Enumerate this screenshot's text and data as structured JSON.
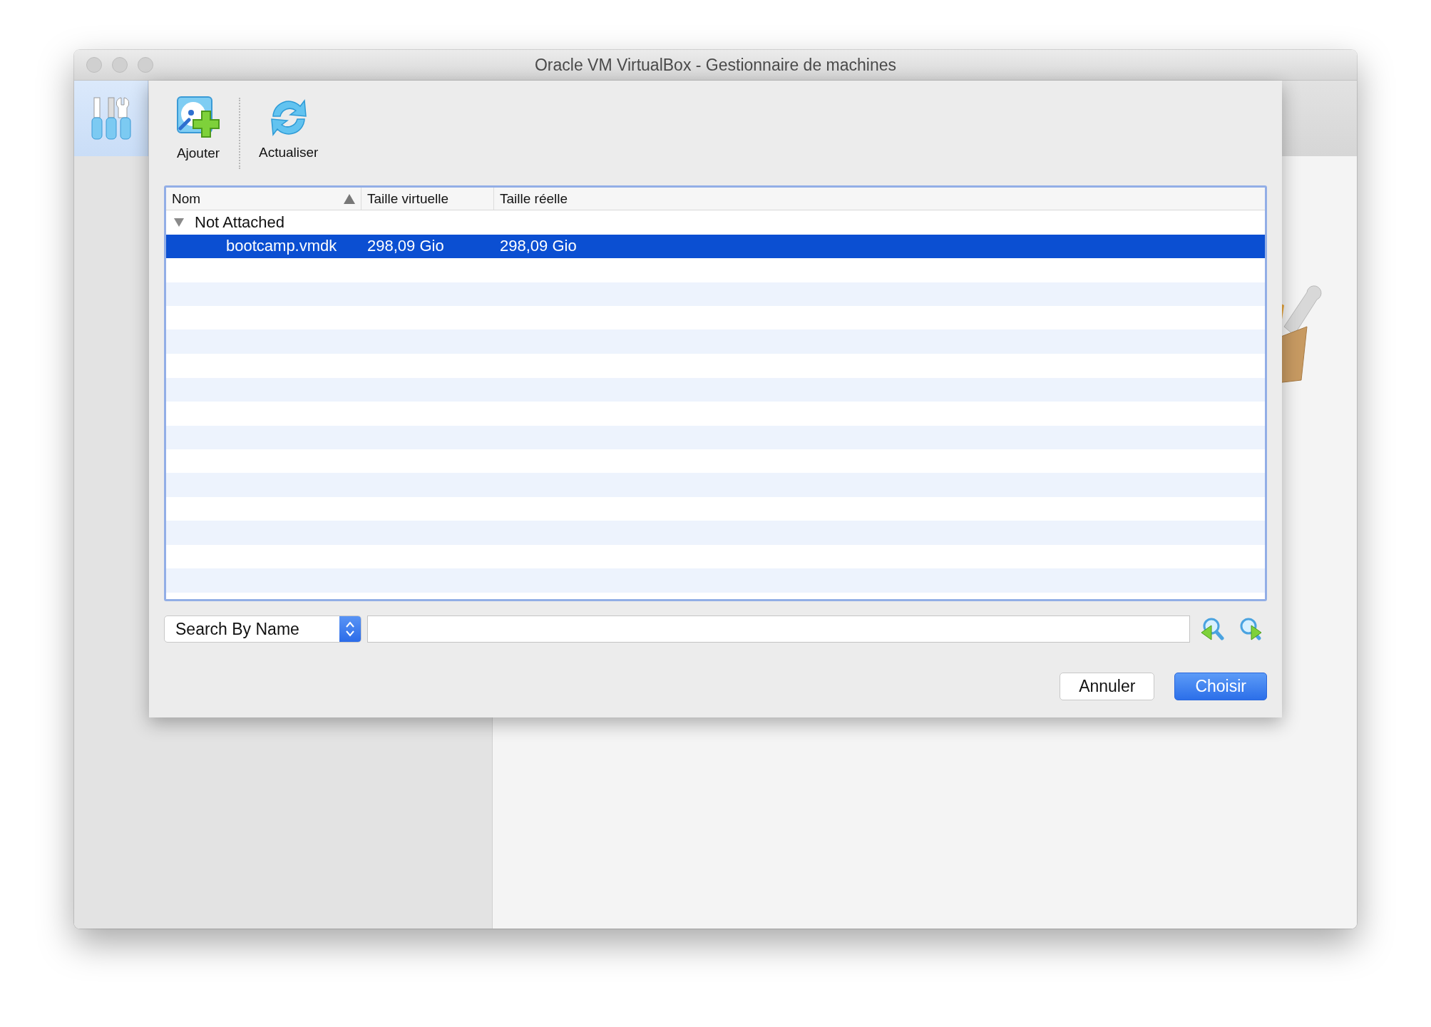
{
  "window": {
    "title": "Oracle VM VirtualBox - Gestionnaire de machines"
  },
  "sidebar": {
    "tools_button": {
      "selected": true
    }
  },
  "toolbar": [
    {
      "label": "Ajouter",
      "kind": "add"
    },
    {
      "label": "Actualiser",
      "kind": "refresh"
    }
  ],
  "table": {
    "columns": [
      {
        "label": "Nom",
        "sorted": true
      },
      {
        "label": "Taille virtuelle",
        "sorted": false
      },
      {
        "label": "Taille réelle",
        "sorted": false
      }
    ],
    "groups": [
      {
        "label": "Not Attached",
        "expanded": true,
        "children": [
          {
            "name": "bootcamp.vmdk",
            "virtual_size": "298,09 Gio",
            "actual_size": "298,09 Gio",
            "selected": true
          }
        ]
      }
    ]
  },
  "search": {
    "mode": "Search By Name"
  },
  "buttons": [
    {
      "label": "Annuler",
      "default": false
    },
    {
      "label": "Choisir",
      "default": true
    }
  ]
}
